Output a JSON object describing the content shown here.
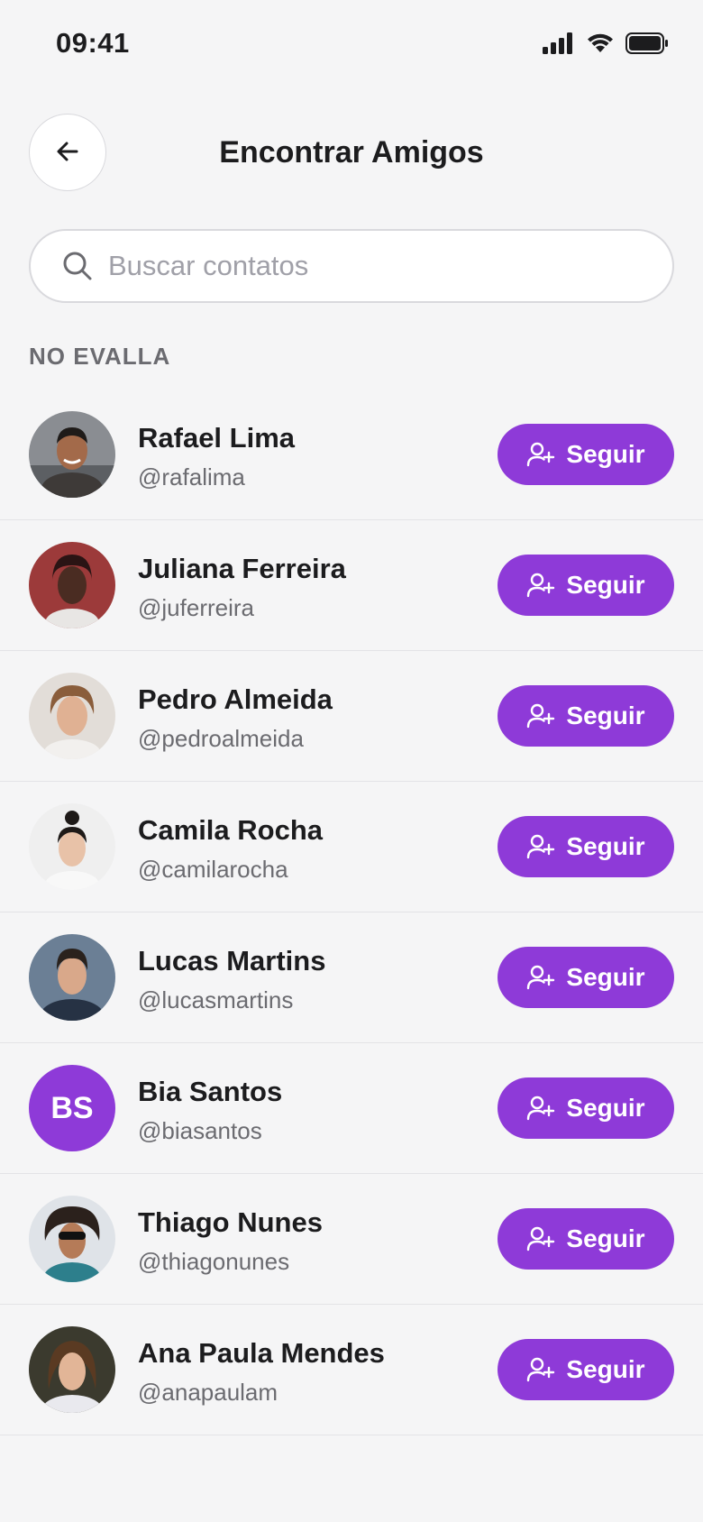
{
  "status_bar": {
    "time": "09:41",
    "icons": [
      "cellular-signal-icon",
      "wifi-icon",
      "battery-icon"
    ]
  },
  "header": {
    "back_icon": "arrow-left-icon",
    "title": "Encontrar Amigos"
  },
  "search": {
    "placeholder": "Buscar contatos",
    "value": "",
    "icon": "search-icon"
  },
  "section": {
    "label": "NO EVALLA"
  },
  "colors": {
    "accent": "#8e3ad8",
    "background": "#f5f5f6",
    "text_primary": "#1c1c1e",
    "text_secondary": "#6b6b70"
  },
  "friends": [
    {
      "name": "Rafael Lima",
      "handle": "@rafalima",
      "button_label": "Seguir",
      "avatar": "photo-avatar-icon"
    },
    {
      "name": "Juliana Ferreira",
      "handle": "@juferreira",
      "button_label": "Seguir",
      "avatar": "photo-avatar-icon"
    },
    {
      "name": "Pedro Almeida",
      "handle": "@pedroalmeida",
      "button_label": "Seguir",
      "avatar": "photo-avatar-icon"
    },
    {
      "name": "Camila Rocha",
      "handle": "@camilarocha",
      "button_label": "Seguir",
      "avatar": "photo-avatar-icon"
    },
    {
      "name": "Lucas Martins",
      "handle": "@lucasmartins",
      "button_label": "Seguir",
      "avatar": "photo-avatar-icon"
    },
    {
      "name": "Bia Santos",
      "handle": "@biasantos",
      "button_label": "Seguir",
      "initials": "BS"
    },
    {
      "name": "Thiago Nunes",
      "handle": "@thiagonunes",
      "button_label": "Seguir",
      "avatar": "photo-avatar-icon"
    },
    {
      "name": "Ana Paula Mendes",
      "handle": "@anapaulam",
      "button_label": "Seguir",
      "avatar": "photo-avatar-icon"
    }
  ]
}
